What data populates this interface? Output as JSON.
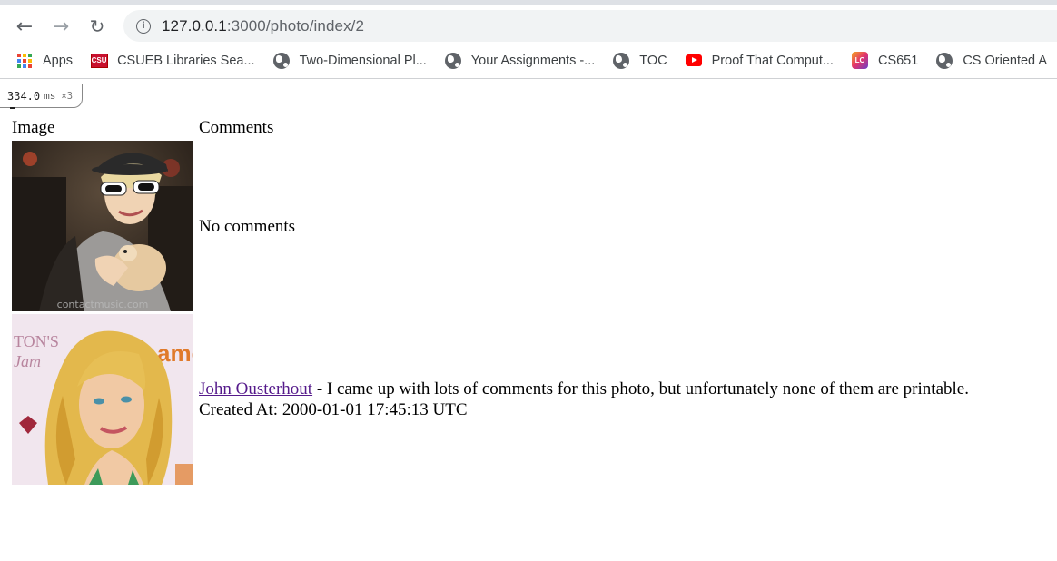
{
  "browser": {
    "url_host": "127.0.0.1",
    "url_path": ":3000/photo/index/2",
    "bookmarks": [
      {
        "label": "Apps",
        "icon": "apps-grid-icon"
      },
      {
        "label": "CSUEB Libraries Sea...",
        "icon": "csu-icon"
      },
      {
        "label": "Two-Dimensional Pl...",
        "icon": "globe-icon"
      },
      {
        "label": "Your Assignments -...",
        "icon": "globe-icon"
      },
      {
        "label": "TOC",
        "icon": "globe-icon"
      },
      {
        "label": "Proof That Comput...",
        "icon": "youtube-icon"
      },
      {
        "label": "CS651",
        "icon": "leetcode-icon"
      },
      {
        "label": "CS Oriented A",
        "icon": "globe-icon"
      }
    ]
  },
  "profiler": {
    "time": "334.0",
    "unit": "ms",
    "count": "×3"
  },
  "table": {
    "headers": {
      "image": "Image",
      "comments": "Comments"
    },
    "rows": [
      {
        "comment_empty": "No comments"
      },
      {
        "author": "John Ousterhout",
        "separator": " - ",
        "comment": "I came up with lots of comments for this photo, but unfortunately none of them are printable.",
        "created_label": "Created At: ",
        "created_at": "2000-01-01 17:45:13 UTC"
      }
    ]
  },
  "photo_texts": {
    "photo1_watermark": "contactmusic.com",
    "photo2_sign_left": "TON'S",
    "photo2_sign_left2": "Jam",
    "photo2_sign_right": "ame"
  },
  "colors": {
    "link_visited": "#551a8b",
    "omnibox_bg": "#f1f3f4"
  }
}
